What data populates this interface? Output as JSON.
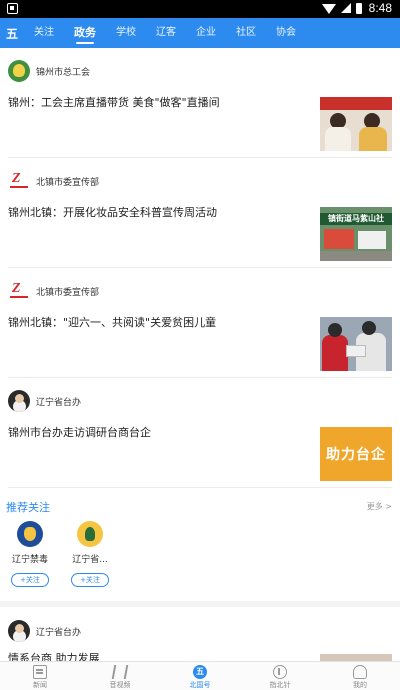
{
  "status_bar": {
    "time": "8:48"
  },
  "tabs": {
    "home_icon": "五",
    "items": [
      "关注",
      "政务",
      "学校",
      "辽客",
      "企业",
      "社区",
      "协会"
    ],
    "active": "政务"
  },
  "posts": [
    {
      "author": "锦州市总工会",
      "avatar_icon": "trade-union-logo",
      "title": "锦州：工会主席直播带货 美食\"做客\"直播间",
      "thumb": "livestream-photo"
    },
    {
      "author": "北镇市委宣传部",
      "avatar_icon": "propaganda-logo",
      "title": "锦州北镇：开展化妆品安全科普宣传周活动",
      "thumb": "street-event-photo",
      "thumb_text": "镇街道马紫山社"
    },
    {
      "author": "北镇市委宣传部",
      "avatar_icon": "propaganda-logo",
      "title": "锦州北镇：\"迎六一、共阅读\"关爱贫困儿童",
      "thumb": "children-reading-photo"
    },
    {
      "author": "辽宁省台办",
      "avatar_icon": "taiwan-office-avatar",
      "title": "锦州市台办走访调研台商台企",
      "thumb": "banner",
      "thumb_text": "助力台企"
    }
  ],
  "recommend": {
    "title": "推荐关注",
    "more": "更多 >",
    "items": [
      {
        "name": "辽宁禁毒",
        "follow": "+关注"
      },
      {
        "name": "辽宁省...",
        "follow": "+关注"
      }
    ]
  },
  "partial_post": {
    "author": "辽宁省台办",
    "title": "情系台商 助力发展"
  },
  "bottom_nav": {
    "items": [
      {
        "label": "新闻",
        "icon": "news-icon"
      },
      {
        "label": "音视频",
        "icon": "video-icon"
      },
      {
        "label": "北国号",
        "icon": "beiguo-icon",
        "glyph": "五"
      },
      {
        "label": "指北针",
        "icon": "compass-icon"
      },
      {
        "label": "我的",
        "icon": "user-icon"
      }
    ],
    "active": "北国号"
  },
  "colors": {
    "accent": "#2d8bf0",
    "status_bar": "#000000",
    "banner_orange": "#f0a62b"
  }
}
